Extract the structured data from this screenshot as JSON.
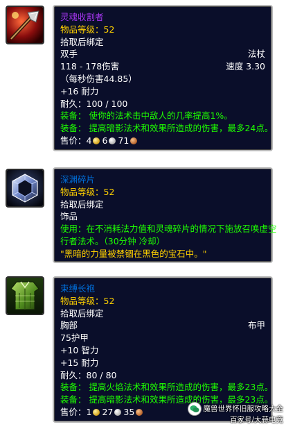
{
  "colors": {
    "epic_name": "#a335ee",
    "rare_name": "#0070dd",
    "item_level": "#ffd100",
    "green_text": "#1eff00",
    "white_text": "#ffffff",
    "tooltip_bg": "#0a0e2a"
  },
  "tooltips": [
    {
      "icon": "soul-harvester-icon",
      "name": "灵魂收割者",
      "item_level": "物品等级：52",
      "bind": "拾取后绑定",
      "slot": "双手",
      "type": "法杖",
      "damage": "118 - 178伤害",
      "speed": "速度 3.30",
      "dps": "（每秒伤害44.85）",
      "stat1": "+16 耐力",
      "durability": "耐久：100 / 100",
      "equip1": "装备： 使你的法术击中敌人的几率提高1%。",
      "equip2": "装备： 提高暗影法术和效果所造成的伤害，最多24点。",
      "sell_label": "售价：",
      "gold": "4",
      "silver": "6",
      "copper": "71"
    },
    {
      "icon": "abyss-shard-icon",
      "name": "深渊碎片",
      "item_level": "物品等级：52",
      "bind": "拾取后绑定",
      "slot": "饰品",
      "use1": "使用：在不消耗法力值和灵魂碎片的情况下施放召唤虚空",
      "use2": "行者法术。（30分钟 冷却）",
      "flavor": "\"黑暗的力量被禁锢在黑色的宝石中。\""
    },
    {
      "icon": "binding-robe-icon",
      "name": "束缚长袍",
      "item_level": "物品等级：52",
      "bind": "拾取后绑定",
      "slot": "胸部",
      "type": "布甲",
      "armor": "75护甲",
      "stat1": "+10 智力",
      "stat2": "+15 耐力",
      "durability": "耐久：80 / 80",
      "equip1": "装备： 提高火焰法术和效果所造成的伤害，最多23点。",
      "equip2": "装备： 提高暗影法术和效果所造成的伤害，最多23点。",
      "sell_label": "售价：",
      "gold": "1",
      "silver": "27",
      "copper": "35"
    }
  ],
  "watermark": {
    "title": "魔兽世界怀旧服攻略大全",
    "subtitle": "百家号/大蒜电竞"
  }
}
